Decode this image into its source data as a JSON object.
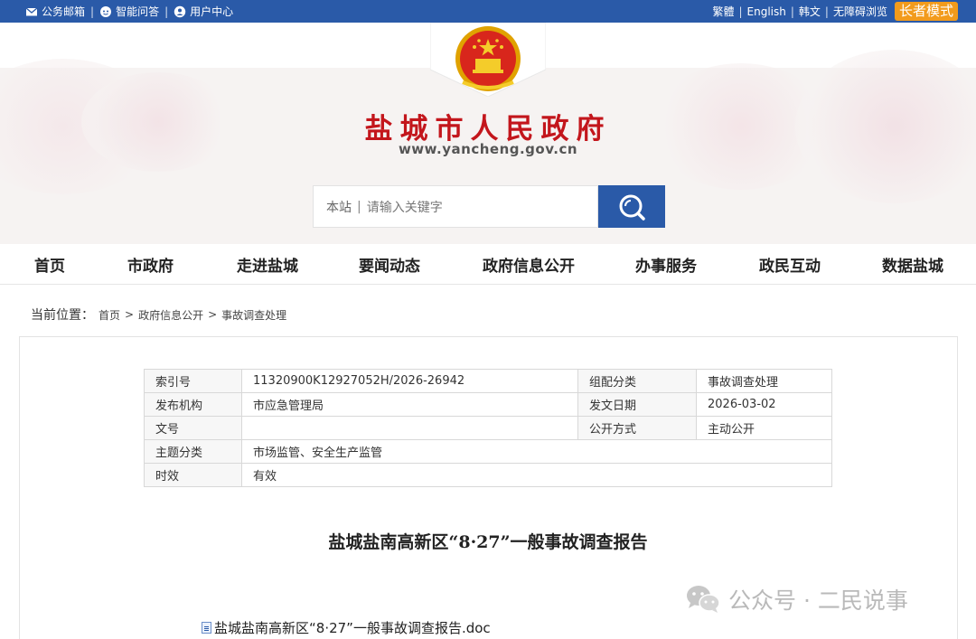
{
  "topbar": {
    "left_items": [
      {
        "icon": "mail-icon",
        "label": "公务邮箱"
      },
      {
        "icon": "smart-qa-icon",
        "label": "智能问答"
      },
      {
        "icon": "user-center-icon",
        "label": "用户中心"
      }
    ],
    "sep": "|",
    "right_links": [
      "繁體",
      "English",
      "韩文",
      "无障碍浏览"
    ],
    "elder_mode": "长者模式",
    "color": "#2a5aa8"
  },
  "header": {
    "emblem": "national-emblem-icon",
    "title": "盐城市人民政府",
    "url": "www.yancheng.gov.cn",
    "title_color": "#c3161c"
  },
  "search": {
    "scope": "本站",
    "divider": "|",
    "placeholder": "请输入关键字",
    "button_icon": "search-icon"
  },
  "nav": {
    "items": [
      "首页",
      "市政府",
      "走进盐城",
      "要闻动态",
      "政府信息公开",
      "办事服务",
      "政民互动",
      "数据盐城"
    ]
  },
  "breadcrumb": {
    "label": "当前位置：",
    "items": [
      "首页",
      "政府信息公开",
      "事故调查处理"
    ],
    "separator": ">"
  },
  "meta": {
    "index_label": "索引号",
    "index_value": "11320900K12927052H/2026-26942",
    "category_label": "组配分类",
    "category_value": "事故调查处理",
    "issuer_label": "发布机构",
    "issuer_value": "市应急管理局",
    "date_label": "发文日期",
    "date_value": "2026-03-02",
    "docno_label": "文号",
    "docno_value": "",
    "open_label": "公开方式",
    "open_value": "主动公开",
    "topic_label": "主题分类",
    "topic_value": "市场监管、安全生产监管",
    "validity_label": "时效",
    "validity_value": "有效"
  },
  "article": {
    "title": "盐城盐南高新区“8·27”一般事故调查报告",
    "attachment": "盐城盐南高新区“8·27”一般事故调查报告.doc"
  },
  "watermark": {
    "text": "公众号 · 二民说事",
    "icon": "wechat-icon"
  }
}
